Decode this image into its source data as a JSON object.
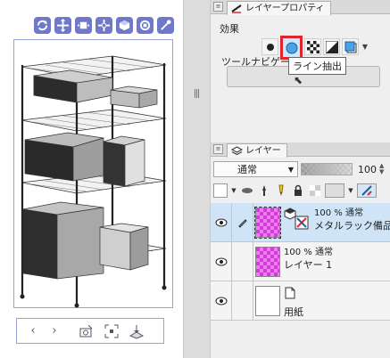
{
  "camera_toolbar": {
    "icons": [
      "rotate-camera-icon",
      "pan-camera-icon",
      "dolly-camera-icon",
      "move-object-icon",
      "rotate-object-icon",
      "rotate-object-z-icon",
      "move-light-icon"
    ]
  },
  "bottom_nav": {
    "prev": "‹",
    "next": "›"
  },
  "layer_property": {
    "tab_label": "レイヤープロパティ",
    "effect_label": "効果",
    "tooltip": "ライン抽出",
    "toolnavi_label": "ツールナビゲーション"
  },
  "layer_panel": {
    "tab_label": "レイヤー",
    "blend_mode": "通常",
    "opacity": "100",
    "layers": [
      {
        "opacity": "100 %",
        "mode": "通常",
        "name": "メタルラック備品",
        "thumb": "magenta",
        "active": true
      },
      {
        "opacity": "100 %",
        "mode": "通常",
        "name": "レイヤー 1",
        "thumb": "magenta",
        "active": false
      },
      {
        "name": "用紙",
        "thumb": "white",
        "active": false
      }
    ]
  },
  "colors": {
    "accent_blue": "#6f78c9",
    "selection_red": "#e0252b",
    "active_layer": "#cfe4f6",
    "layer_magenta": "#d23cd6"
  }
}
